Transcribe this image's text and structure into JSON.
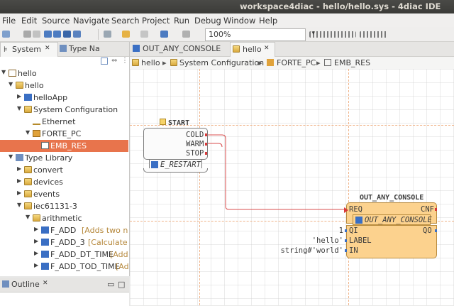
{
  "window": {
    "title": "workspace4diac - hello/hello.sys - 4diac IDE"
  },
  "menu": [
    "File",
    "Edit",
    "Source",
    "Navigate",
    "Search",
    "Project",
    "Run",
    "Debug",
    "Window",
    "Help"
  ],
  "toolbar": {
    "zoom": "100%"
  },
  "left_panel": {
    "tabs": [
      {
        "label": "System",
        "active": true
      },
      {
        "label": "Type Na",
        "active": false
      }
    ],
    "tree": [
      {
        "label": "hello",
        "level": 0,
        "arrow": "▼"
      },
      {
        "label": "hello",
        "level": 1,
        "arrow": "▼"
      },
      {
        "label": "helloApp",
        "level": 2,
        "arrow": "▶"
      },
      {
        "label": "System Configuration",
        "level": 2,
        "arrow": "▼"
      },
      {
        "label": "Ethernet",
        "level": 3,
        "arrow": ""
      },
      {
        "label": "FORTE_PC",
        "level": 3,
        "arrow": "▼"
      },
      {
        "label": "EMB_RES",
        "level": 4,
        "arrow": "",
        "selected": true
      },
      {
        "label": "Type Library",
        "level": 1,
        "arrow": "▼"
      },
      {
        "label": "convert",
        "level": 2,
        "arrow": "▶"
      },
      {
        "label": "devices",
        "level": 2,
        "arrow": "▶"
      },
      {
        "label": "events",
        "level": 2,
        "arrow": "▶"
      },
      {
        "label": "iec61131-3",
        "level": 2,
        "arrow": "▼"
      },
      {
        "label": "arithmetic",
        "level": 3,
        "arrow": "▼"
      },
      {
        "label": "F_ADD",
        "hint": "[Adds two num",
        "level": 4,
        "arrow": "▶"
      },
      {
        "label": "F_ADD_3",
        "hint": "[Calculate ar",
        "level": 4,
        "arrow": "▶"
      },
      {
        "label": "F_ADD_DT_TIME",
        "hint": "[Add",
        "level": 4,
        "arrow": "▶"
      },
      {
        "label": "F_ADD_TOD_TIME",
        "hint": "[Ad",
        "level": 4,
        "arrow": "▶"
      }
    ],
    "outline_label": "Outline"
  },
  "editor": {
    "tabs": [
      {
        "label": "OUT_ANY_CONSOLE",
        "active": false
      },
      {
        "label": "hello",
        "active": true
      }
    ],
    "breadcrumb": [
      "hello",
      "System Configuration",
      "FORTE_PC",
      "EMB_RES"
    ]
  },
  "diagram": {
    "start_block": {
      "name": "START",
      "outputs": [
        "COLD",
        "WARM",
        "STOP"
      ],
      "type": "E_RESTART"
    },
    "console_block": {
      "name": "OUT_ANY_CONSOLE",
      "event_in": "REQ",
      "event_out": "CNF",
      "type": "OUT_ANY_CONSOLE",
      "data_in": [
        {
          "name": "QI",
          "value": "1"
        },
        {
          "name": "LABEL",
          "value": "'hello'"
        },
        {
          "name": "IN",
          "value": "string#'world'"
        }
      ],
      "data_out": "QO"
    }
  },
  "colors": {
    "selection": "#e8744c",
    "fb_blue": "#3a6fc4",
    "connection": "#d84c4c",
    "block_orange": "#fcd28e"
  }
}
